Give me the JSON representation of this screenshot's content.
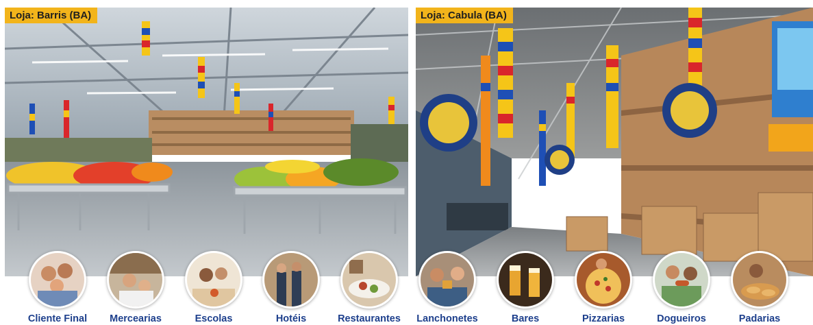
{
  "stores": [
    {
      "label": "Loja: Barris (BA)"
    },
    {
      "label": "Loja: Cabula (BA)"
    }
  ],
  "segments": [
    {
      "label": "Cliente Final",
      "icon": "family-photo-icon"
    },
    {
      "label": "Mercearias",
      "icon": "grocery-photo-icon"
    },
    {
      "label": "Escolas",
      "icon": "school-photo-icon"
    },
    {
      "label": "Hotéis",
      "icon": "hotel-photo-icon"
    },
    {
      "label": "Restaurantes",
      "icon": "restaurant-photo-icon"
    },
    {
      "label": "Lanchonetes",
      "icon": "snack-bar-photo-icon"
    },
    {
      "label": "Bares",
      "icon": "bar-photo-icon"
    },
    {
      "label": "Pizzarias",
      "icon": "pizza-photo-icon"
    },
    {
      "label": "Dogueiros",
      "icon": "hotdog-photo-icon"
    },
    {
      "label": "Padarias",
      "icon": "bakery-photo-icon"
    }
  ],
  "colors": {
    "store_tag_bg": "#f2b41b",
    "segment_label": "#1d3f8c",
    "balloon_yellow": "#f5c518",
    "balloon_red": "#d9262b",
    "balloon_blue": "#1e4fb5"
  }
}
